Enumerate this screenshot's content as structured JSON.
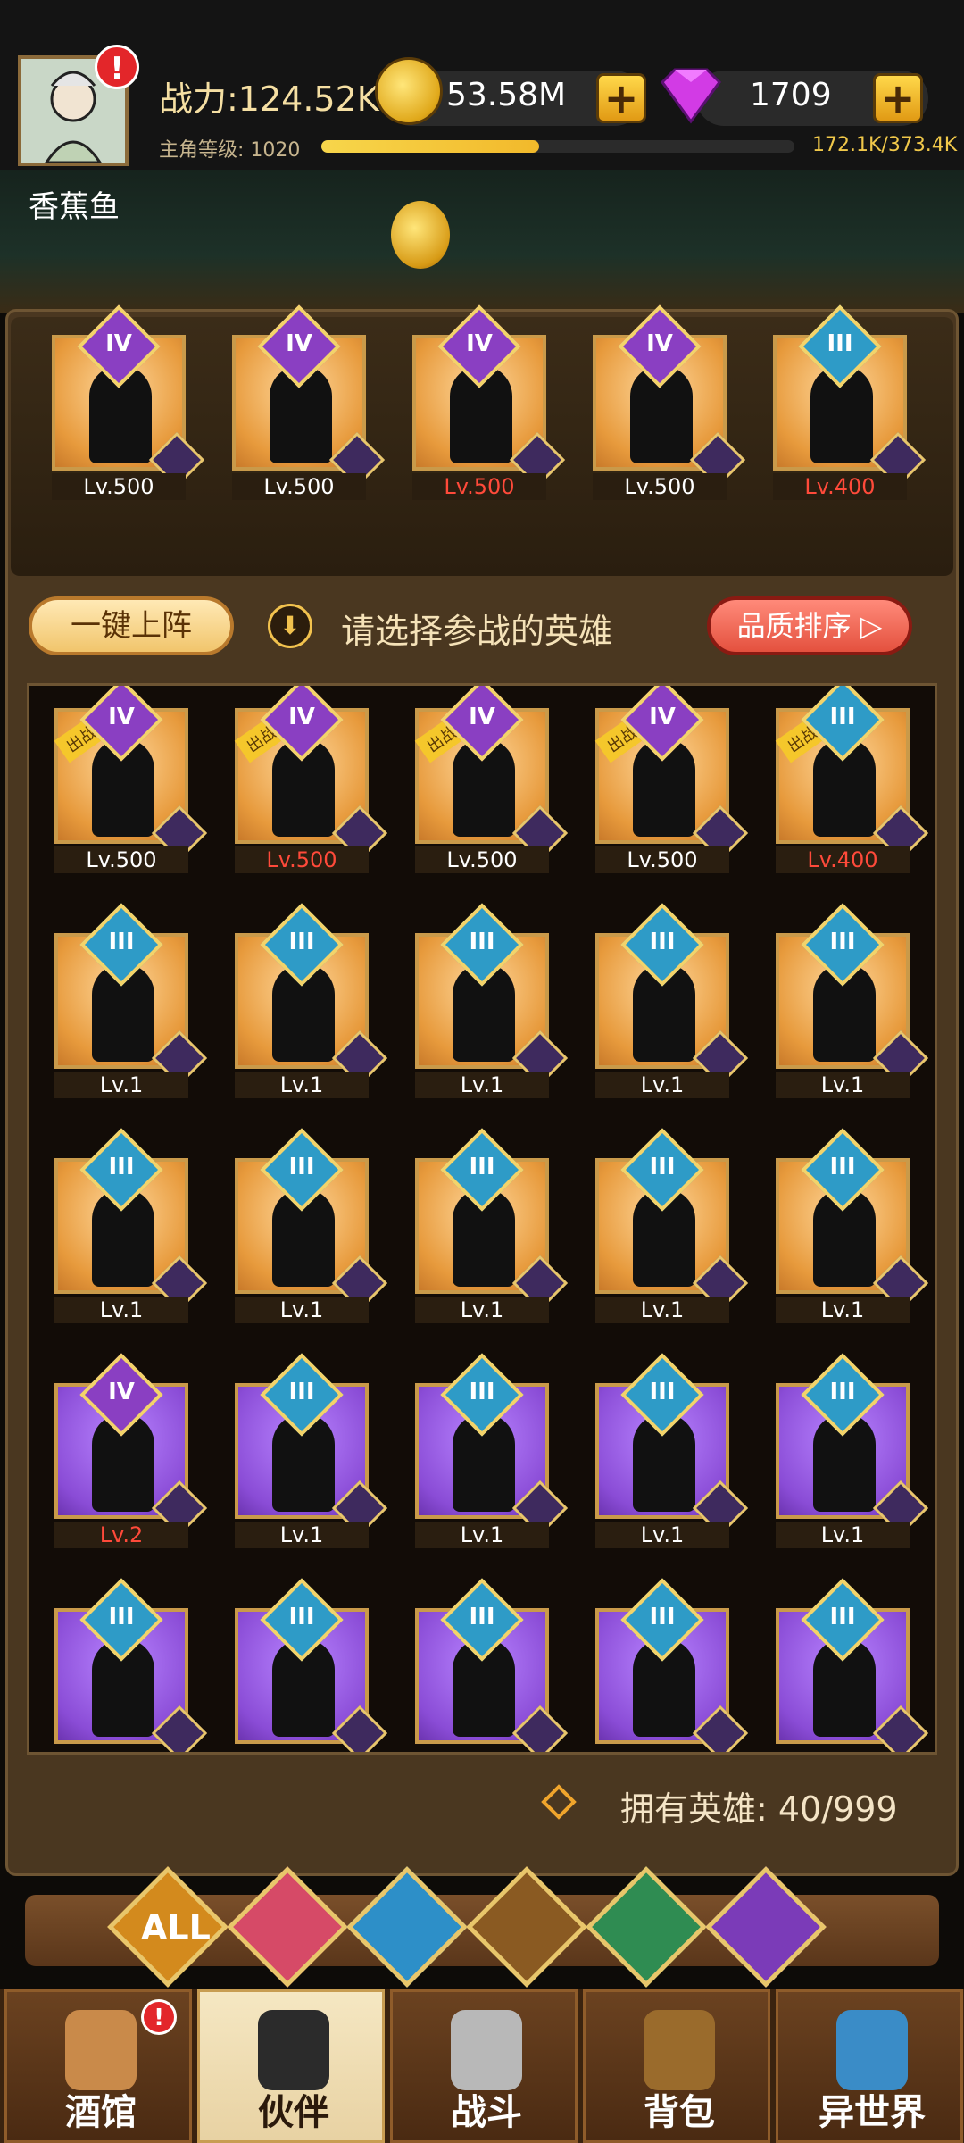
{
  "header": {
    "power": "战力:124.52K",
    "level_label": "主角等级: 1020",
    "exp": {
      "value_text": "172.1K/373.4K",
      "progress": 0.46
    },
    "gold": "53.58M",
    "gems": "1709",
    "alert": "!",
    "player_name": "香蕉鱼"
  },
  "team": [
    {
      "rank": "IV",
      "level": "Lv.500",
      "red": false,
      "bg": "gold"
    },
    {
      "rank": "IV",
      "level": "Lv.500",
      "red": false,
      "bg": "gold"
    },
    {
      "rank": "IV",
      "level": "Lv.500",
      "red": true,
      "bg": "gold"
    },
    {
      "rank": "IV",
      "level": "Lv.500",
      "red": false,
      "bg": "gold"
    },
    {
      "rank": "III",
      "level": "Lv.400",
      "red": true,
      "bg": "gold"
    }
  ],
  "controls": {
    "one_click": "一键上阵",
    "hint": "请选择参战的英雄",
    "sort": "品质排序",
    "in_battle": "出战中"
  },
  "heroes": [
    {
      "rank": "IV",
      "level": "Lv.500",
      "red": false,
      "bg": "gold",
      "battle": true
    },
    {
      "rank": "IV",
      "level": "Lv.500",
      "red": true,
      "bg": "gold",
      "battle": true
    },
    {
      "rank": "IV",
      "level": "Lv.500",
      "red": false,
      "bg": "gold",
      "battle": true
    },
    {
      "rank": "IV",
      "level": "Lv.500",
      "red": false,
      "bg": "gold",
      "battle": true
    },
    {
      "rank": "III",
      "level": "Lv.400",
      "red": true,
      "bg": "gold",
      "battle": true
    },
    {
      "rank": "III",
      "level": "Lv.1",
      "red": false,
      "bg": "gold",
      "battle": false
    },
    {
      "rank": "III",
      "level": "Lv.1",
      "red": false,
      "bg": "gold",
      "battle": false
    },
    {
      "rank": "III",
      "level": "Lv.1",
      "red": false,
      "bg": "gold",
      "battle": false
    },
    {
      "rank": "III",
      "level": "Lv.1",
      "red": false,
      "bg": "gold",
      "battle": false
    },
    {
      "rank": "III",
      "level": "Lv.1",
      "red": false,
      "bg": "gold",
      "battle": false
    },
    {
      "rank": "III",
      "level": "Lv.1",
      "red": false,
      "bg": "gold",
      "battle": false
    },
    {
      "rank": "III",
      "level": "Lv.1",
      "red": false,
      "bg": "gold",
      "battle": false
    },
    {
      "rank": "III",
      "level": "Lv.1",
      "red": false,
      "bg": "gold",
      "battle": false
    },
    {
      "rank": "III",
      "level": "Lv.1",
      "red": false,
      "bg": "gold",
      "battle": false
    },
    {
      "rank": "III",
      "level": "Lv.1",
      "red": false,
      "bg": "gold",
      "battle": false
    },
    {
      "rank": "IV",
      "level": "Lv.2",
      "red": true,
      "bg": "purple",
      "battle": false
    },
    {
      "rank": "III",
      "level": "Lv.1",
      "red": false,
      "bg": "purple",
      "battle": false
    },
    {
      "rank": "III",
      "level": "Lv.1",
      "red": false,
      "bg": "purple",
      "battle": false
    },
    {
      "rank": "III",
      "level": "Lv.1",
      "red": false,
      "bg": "purple",
      "battle": false
    },
    {
      "rank": "III",
      "level": "Lv.1",
      "red": false,
      "bg": "purple",
      "battle": false
    },
    {
      "rank": "III",
      "level": "",
      "red": false,
      "bg": "purple",
      "battle": false
    },
    {
      "rank": "III",
      "level": "",
      "red": false,
      "bg": "purple",
      "battle": false
    },
    {
      "rank": "III",
      "level": "",
      "red": false,
      "bg": "purple",
      "battle": false
    },
    {
      "rank": "III",
      "level": "",
      "red": false,
      "bg": "purple",
      "battle": false
    },
    {
      "rank": "III",
      "level": "",
      "red": false,
      "bg": "purple",
      "battle": false
    }
  ],
  "owned": "拥有英雄: 40/999",
  "filters": [
    {
      "label": "ALL",
      "color": "#d38a1d"
    },
    {
      "label": "",
      "color": "#d64a67"
    },
    {
      "label": "",
      "color": "#2d8fc8"
    },
    {
      "label": "",
      "color": "#8a5a22"
    },
    {
      "label": "",
      "color": "#2f8c52"
    },
    {
      "label": "",
      "color": "#7b3bb8"
    }
  ],
  "nav": [
    {
      "label": "酒馆",
      "alert": "!"
    },
    {
      "label": "伙伴",
      "active": true
    },
    {
      "label": "战斗"
    },
    {
      "label": "背包"
    },
    {
      "label": "异世界"
    }
  ]
}
